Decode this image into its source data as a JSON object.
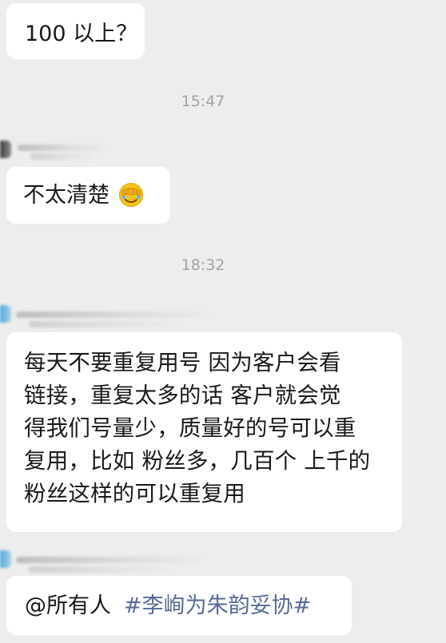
{
  "messages": [
    {
      "text": "100 以上？"
    },
    {
      "text": "不太清楚",
      "emoji": "face-with-hand-over-eyes-emoji"
    },
    {
      "text_lines": [
        "每天不要重复用号  因为客户会看",
        "链接，重复太多的话  客户就会觉",
        "得我们号量少，质量好的号可以重",
        "复用，比如 粉丝多，几百个 上千的",
        "粉丝这样的可以重复用"
      ]
    },
    {
      "mention": "@所有人",
      "topic": "#李峋为朱韵妥协#"
    }
  ],
  "timestamps": [
    "15:47",
    "18:32"
  ],
  "colors": {
    "background": "#ededed",
    "bubble": "#ffffff",
    "text": "#191919",
    "timestamp": "#a3a3a3",
    "topic_link": "#576b95"
  }
}
